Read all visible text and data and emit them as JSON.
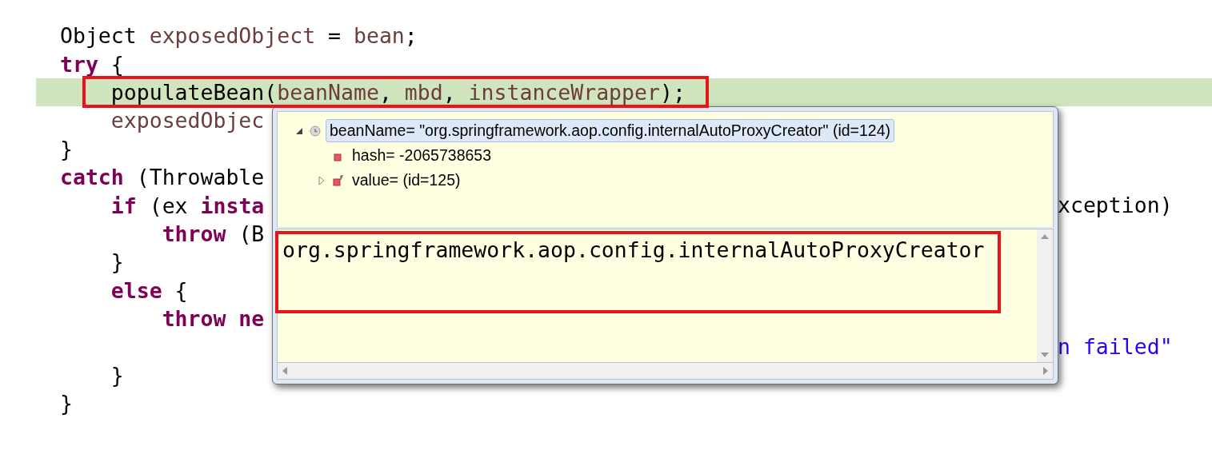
{
  "code": {
    "lines": [
      {
        "current": false,
        "segments": [
          {
            "kind": "plain",
            "text": "Object "
          },
          {
            "kind": "variable",
            "text": "exposedObject"
          },
          {
            "kind": "plain",
            "text": " = "
          },
          {
            "kind": "variable",
            "text": "bean"
          },
          {
            "kind": "plain",
            "text": ";"
          }
        ]
      },
      {
        "current": false,
        "segments": [
          {
            "kind": "keyword",
            "text": "try"
          },
          {
            "kind": "plain",
            "text": " {"
          }
        ]
      },
      {
        "current": true,
        "segments": [
          {
            "kind": "plain",
            "text": "    populateBean("
          },
          {
            "kind": "variable",
            "text": "beanName"
          },
          {
            "kind": "plain",
            "text": ", "
          },
          {
            "kind": "variable",
            "text": "mbd"
          },
          {
            "kind": "plain",
            "text": ", "
          },
          {
            "kind": "variable",
            "text": "instanceWrapper"
          },
          {
            "kind": "plain",
            "text": ");"
          }
        ]
      },
      {
        "current": false,
        "segments": [
          {
            "kind": "variable",
            "text": "    exposedObjec"
          }
        ]
      },
      {
        "current": false,
        "segments": [
          {
            "kind": "plain",
            "text": "}"
          }
        ]
      },
      {
        "current": false,
        "segments": [
          {
            "kind": "keyword",
            "text": "catch"
          },
          {
            "kind": "plain",
            "text": " (Throwable"
          }
        ]
      },
      {
        "current": false,
        "segments": [
          {
            "kind": "keyword",
            "text": "    if"
          },
          {
            "kind": "plain",
            "text": " (ex "
          },
          {
            "kind": "keyword",
            "text": "insta"
          }
        ],
        "right": [
          {
            "kind": "plain",
            "text": "xception)"
          }
        ]
      },
      {
        "current": false,
        "segments": [
          {
            "kind": "keyword",
            "text": "        throw"
          },
          {
            "kind": "plain",
            "text": " (B"
          }
        ]
      },
      {
        "current": false,
        "segments": [
          {
            "kind": "plain",
            "text": "    }"
          }
        ]
      },
      {
        "current": false,
        "segments": [
          {
            "kind": "keyword",
            "text": "    else"
          },
          {
            "kind": "plain",
            "text": " {"
          }
        ]
      },
      {
        "current": false,
        "segments": [
          {
            "kind": "keyword",
            "text": "        throw ne"
          }
        ]
      },
      {
        "current": false,
        "right": [
          {
            "kind": "string",
            "text": "n failed\""
          }
        ]
      },
      {
        "current": false,
        "segments": [
          {
            "kind": "plain",
            "text": "    }"
          }
        ]
      },
      {
        "current": false,
        "segments": [
          {
            "kind": "plain",
            "text": "}"
          }
        ]
      }
    ]
  },
  "inspector": {
    "tree": [
      {
        "label": "beanName= \"org.springframework.aop.config.internalAutoProxyCreator\" (id=124)",
        "kind": "object",
        "selected": true,
        "expanded": true,
        "children": [
          {
            "label": "hash= -2065738653",
            "kind": "field",
            "selected": false
          },
          {
            "label": "value= (id=125)",
            "kind": "final-field",
            "selected": false,
            "expanded": false
          }
        ]
      }
    ],
    "detail": "org.springframework.aop.config.internalAutoProxyCreator"
  }
}
